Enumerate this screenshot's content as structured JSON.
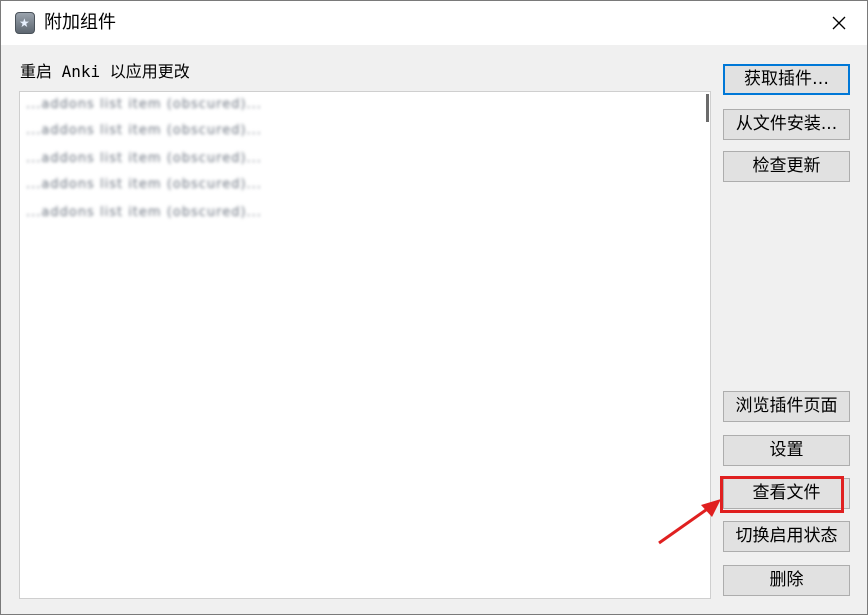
{
  "window": {
    "title": "附加组件",
    "app_icon": "anki-star-icon",
    "close_icon": "close-icon"
  },
  "main": {
    "restart_notice": "重启 Anki 以应用更改",
    "addon_items": [
      "...addons list item (obscured)...",
      "...addons list item (obscured)...",
      "...addons list item (obscured)...",
      "...addons list item (obscured)...",
      "...addons list item (obscured)..."
    ]
  },
  "sidebar": {
    "get_addons": "获取插件…",
    "install_from_file": "从文件安装...",
    "check_updates": "检查更新",
    "browse_addon_page": "浏览插件页面",
    "settings": "设置",
    "view_files": "查看文件",
    "toggle_enabled": "切换启用状态",
    "delete": "删除"
  },
  "annotation": {
    "highlight_color": "#e02020",
    "highlight_target": "view_files"
  }
}
